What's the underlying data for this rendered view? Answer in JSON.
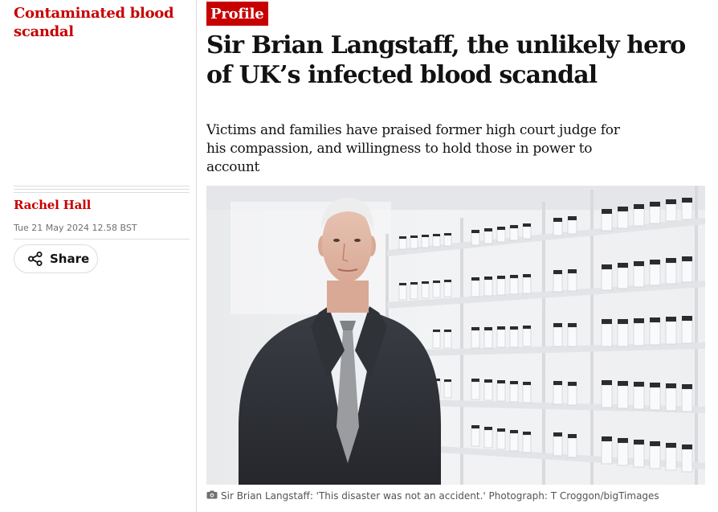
{
  "section": {
    "title": "Contaminated blood scandal"
  },
  "byline": {
    "author": "Rachel Hall",
    "date": "Tue 21 May 2024 12.58 BST"
  },
  "share": {
    "label": "Share",
    "icon": "share-icon"
  },
  "article": {
    "kicker": "Profile",
    "headline": "Sir Brian Langstaff, the unlikely hero of UK’s infected blood scandal",
    "standfirst": "Victims and families have praised former high court judge for his compassion, and willingness to hold those in power to account"
  },
  "photo": {
    "caption": "Sir Brian Langstaff: 'This disaster was not an accident.' Photograph: T Croggon/bigTimages",
    "caption_icon": "camera-icon"
  },
  "colors": {
    "accent": "#c70000",
    "text": "#121212",
    "muted": "#707070",
    "rule": "#dcdcdc"
  }
}
